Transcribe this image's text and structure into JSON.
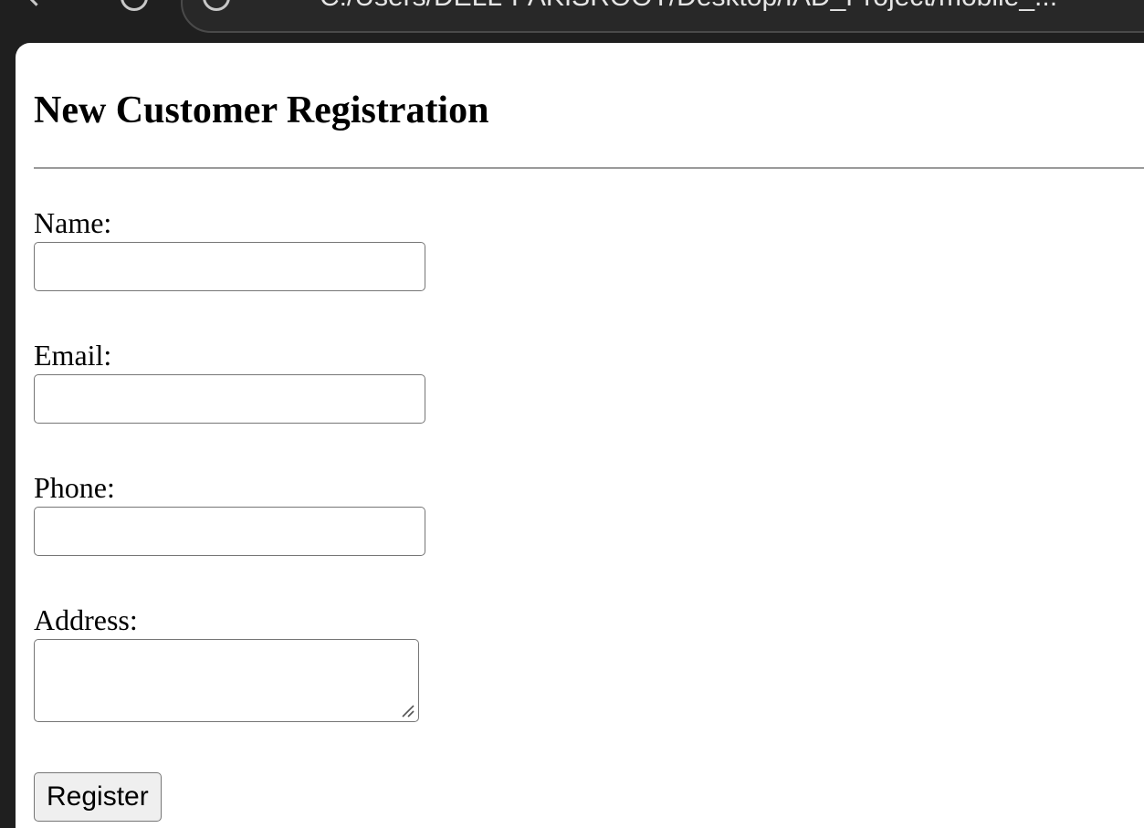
{
  "browser": {
    "url": "C:/Users/DELL-PAKISROOT/Desktop/IAD_Project/mobile_..."
  },
  "page": {
    "title": "New Customer Registration"
  },
  "form": {
    "name_label": "Name:",
    "name_value": "",
    "email_label": "Email:",
    "email_value": "",
    "phone_label": "Phone:",
    "phone_value": "",
    "address_label": "Address:",
    "address_value": "",
    "submit_label": "Register"
  },
  "icons": {
    "back": "back-arrow-icon",
    "forward": "forward-icon",
    "reload": "reload-icon",
    "resize": "resize-grip-icon"
  }
}
